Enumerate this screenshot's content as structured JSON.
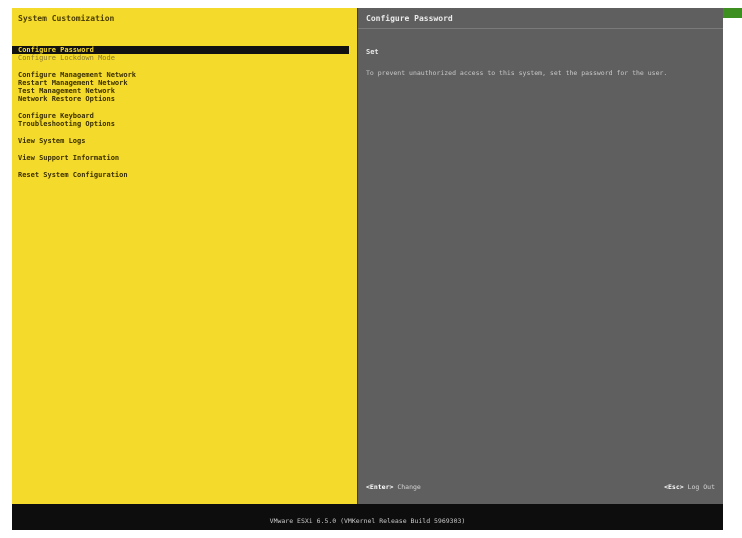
{
  "left_panel": {
    "title": "System Customization",
    "menu": [
      {
        "label": "Configure Password",
        "state": "selected"
      },
      {
        "label": "Configure Lockdown Mode",
        "state": "dim"
      },
      {
        "label": "Configure Management Network",
        "state": "normal",
        "gap_before": true
      },
      {
        "label": "Restart Management Network",
        "state": "normal"
      },
      {
        "label": "Test Management Network",
        "state": "normal"
      },
      {
        "label": "Network Restore Options",
        "state": "normal"
      },
      {
        "label": "Configure Keyboard",
        "state": "normal",
        "gap_before": true
      },
      {
        "label": "Troubleshooting Options",
        "state": "normal"
      },
      {
        "label": "View System Logs",
        "state": "normal",
        "gap_before": true
      },
      {
        "label": "View Support Information",
        "state": "normal",
        "gap_before": true
      },
      {
        "label": "Reset System Configuration",
        "state": "normal",
        "gap_before": true
      }
    ]
  },
  "right_panel": {
    "title": "Configure Password",
    "status": "Set",
    "description": "To prevent unauthorized access to this system, set the password for the user."
  },
  "footer": {
    "enter_key": "<Enter>",
    "enter_action": "Change",
    "esc_key": "<Esc>",
    "esc_action": "Log Out"
  },
  "status_bar": {
    "text": "VMware ESXi 6.5.0 (VMKernel Release Build 5969303)"
  },
  "colors": {
    "left_bg": "#f4da2b",
    "right_bg": "#5f5f5f",
    "selection": "#111111",
    "overlay_bar": "#3d8f20"
  }
}
